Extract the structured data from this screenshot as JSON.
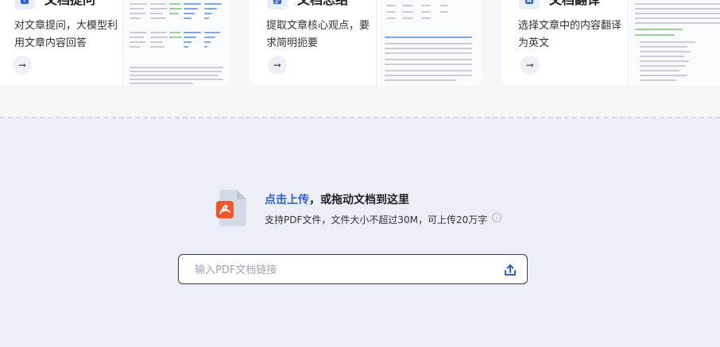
{
  "cards": [
    {
      "title": "文档提问",
      "description": "对文章提问，大模型利用文章内容回答",
      "arrow": "➞",
      "icon": "doc-question-icon"
    },
    {
      "title": "文档总结",
      "description": "提取文章核心观点，要求简明扼要",
      "arrow": "➞",
      "icon": "doc-summary-icon"
    },
    {
      "title": "文档翻译",
      "description": "选择文章中的内容翻译为英文",
      "arrow": "➞",
      "icon": "doc-translate-icon"
    }
  ],
  "upload": {
    "link_text": "点击上传",
    "title_rest": "，或拖动文档到这里",
    "hint": "支持PDF文件，文件大小不超过30M，可上传20万字",
    "url_placeholder": "输入PDF文档链接"
  },
  "colors": {
    "accent": "#2f5fe3",
    "pdf_red": "#f0562a",
    "upload_bg": "#eceef8"
  }
}
